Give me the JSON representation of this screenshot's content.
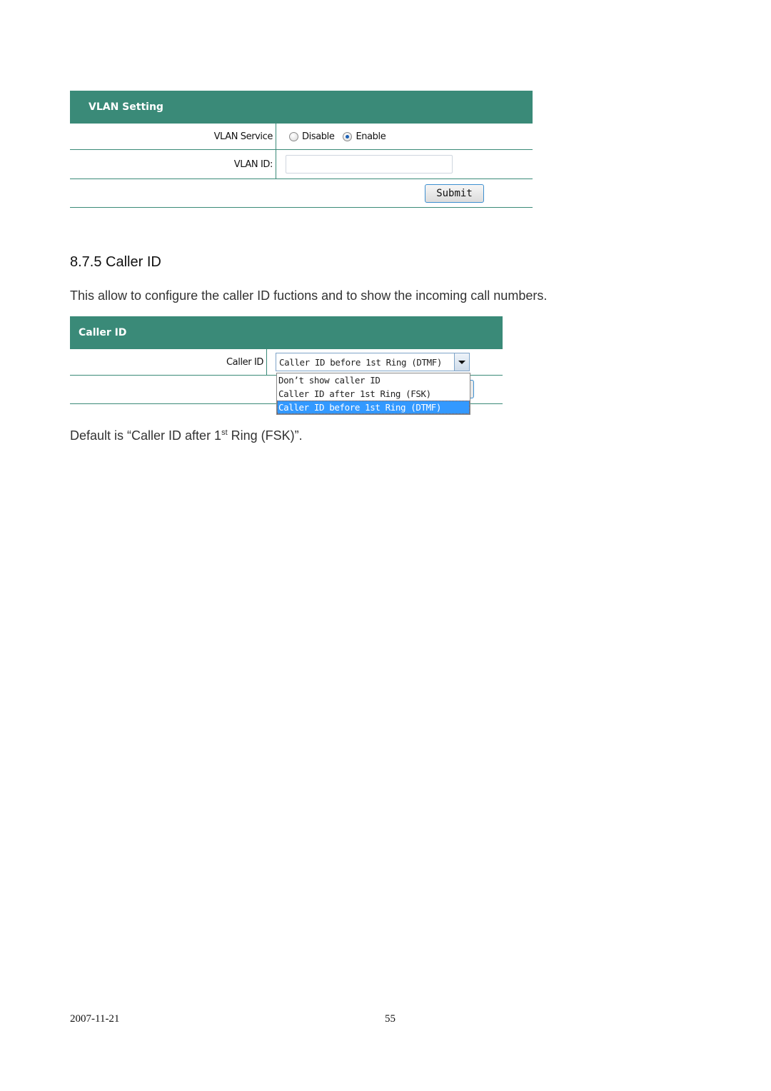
{
  "vlan_panel": {
    "title": "VLAN Setting",
    "service_label": "VLAN Service",
    "options": [
      {
        "label": "Disable",
        "checked": false
      },
      {
        "label": "Enable",
        "checked": true
      }
    ],
    "id_label": "VLAN ID:",
    "id_value": "",
    "submit_label": "Submit"
  },
  "section": {
    "heading": "8.7.5 Caller ID",
    "intro": "This allow to configure the caller ID fuctions and to show the incoming call numbers.",
    "default_prefix": "Default is “Caller ID after 1",
    "default_sup": "st",
    "default_suffix": " Ring (FSK)”."
  },
  "caller_panel": {
    "title": "Caller ID",
    "field_label": "Caller ID",
    "selected_display": "Caller ID before 1st Ring (DTMF)",
    "options": [
      "Don’t show caller ID",
      "Caller ID after 1st Ring (FSK)",
      "Caller ID before 1st Ring (DTMF)"
    ],
    "highlighted_index": 2
  },
  "footer": {
    "date": "2007-11-21",
    "page": "55"
  },
  "colors": {
    "header_bg": "#3a8a78",
    "highlight": "#3399ff"
  }
}
